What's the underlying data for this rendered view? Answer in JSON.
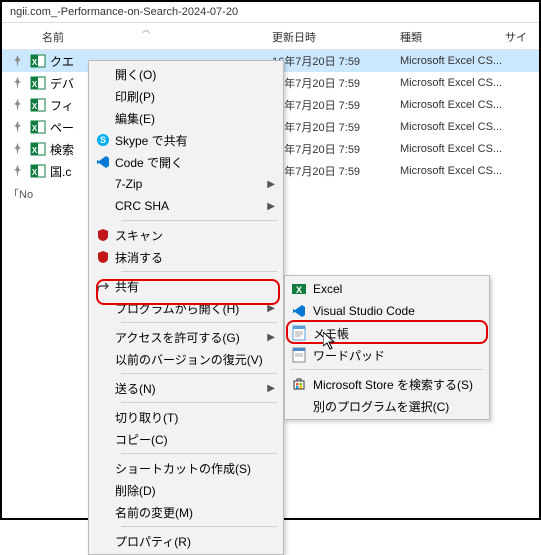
{
  "window": {
    "title": "ngii.com_-Performance-on-Search-2024-07-20"
  },
  "columns": {
    "name": "名前",
    "date": "更新日時",
    "type": "種類",
    "size": "サイ"
  },
  "rows": [
    {
      "pin": true,
      "icon": "excel",
      "name": "クエ",
      "date": "16年7月20日 7:59",
      "type": "Microsoft Excel CS...",
      "selected": true
    },
    {
      "pin": true,
      "icon": "excel",
      "name": "デバ",
      "date": "16年7月20日 7:59",
      "type": "Microsoft Excel CS..."
    },
    {
      "pin": true,
      "icon": "excel",
      "name": "フィ",
      "date": "16年7月20日 7:59",
      "type": "Microsoft Excel CS..."
    },
    {
      "pin": true,
      "icon": "excel",
      "name": "ペー",
      "date": "16年7月20日 7:59",
      "type": "Microsoft Excel CS..."
    },
    {
      "pin": true,
      "icon": "excel",
      "name": "検索",
      "date": "16年7月20日 7:59",
      "type": "Microsoft Excel CS..."
    },
    {
      "pin": true,
      "icon": "excel",
      "name": "国.c",
      "date": "16年7月20日 7:59",
      "type": "Microsoft Excel CS..."
    }
  ],
  "no_preview": "「No",
  "ctx": {
    "open": "開く(O)",
    "print": "印刷(P)",
    "edit": "編集(E)",
    "skype": "Skype で共有",
    "code": "Code で開く",
    "sevenzip": "7-Zip",
    "crcsha": "CRC SHA",
    "scan": "スキャン",
    "shred": "抹消する",
    "share": "共有",
    "openwith": "プログラムから開く(H)",
    "access": "アクセスを許可する(G)",
    "restore": "以前のバージョンの復元(V)",
    "sendto": "送る(N)",
    "cut": "切り取り(T)",
    "copy": "コピー(C)",
    "shortcut": "ショートカットの作成(S)",
    "delete": "削除(D)",
    "rename": "名前の変更(M)",
    "props": "プロパティ(R)"
  },
  "sub": {
    "excel": "Excel",
    "vscode": "Visual Studio Code",
    "notepad": "メモ帳",
    "wordpad": "ワードパッド",
    "store": "Microsoft Store を検索する(S)",
    "other": "別のプログラムを選択(C)"
  }
}
